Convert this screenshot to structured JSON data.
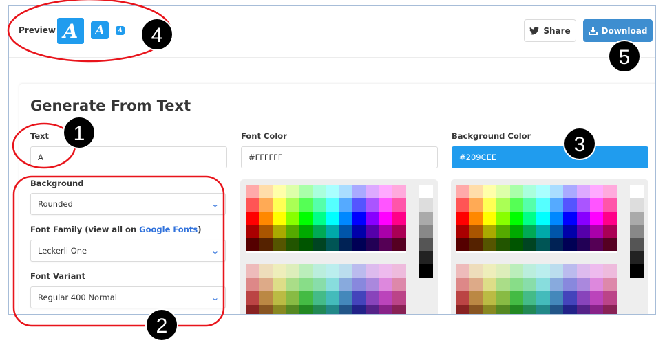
{
  "header": {
    "preview_label": "Preview",
    "preview_glyph": "A",
    "share_label": "Share",
    "share_icon": "twitter-icon",
    "download_label": "Download",
    "download_icon": "download-icon"
  },
  "form": {
    "title": "Generate From Text",
    "text_label": "Text",
    "text_value": "A",
    "font_color_label": "Font Color",
    "font_color_value": "#FFFFFF",
    "bg_color_label": "Background Color",
    "bg_color_value": "#209CEE",
    "background_label": "Background",
    "background_value": "Rounded",
    "font_family_label": "Font Family (view all on ",
    "font_family_link": "Google Fonts",
    "font_family_label_end": ")",
    "font_family_value": "Leckerli One",
    "font_variant_label": "Font Variant",
    "font_variant_value": "Regular 400 Normal"
  },
  "colors": {
    "accent": "#209CEE",
    "download": "#3E8ED0",
    "annotation": "#E8141B"
  },
  "palette": [
    [
      "#ffaaaa",
      "#ffddaa",
      "#ffffaa",
      "#ddffaa",
      "#aaffaa",
      "#aaffdd",
      "#aaffff",
      "#aaddff",
      "#aaaaff",
      "#ddaaff",
      "#ffaaff",
      "#ffaadd"
    ],
    [
      "#ff5555",
      "#ffaa55",
      "#ffff55",
      "#aaff55",
      "#55ff55",
      "#55ffaa",
      "#55ffff",
      "#55aaff",
      "#5555ff",
      "#aa55ff",
      "#ff55ff",
      "#ff55aa"
    ],
    [
      "#ff0000",
      "#ff8800",
      "#ffff00",
      "#88ff00",
      "#00ff00",
      "#00ff88",
      "#00ffff",
      "#0088ff",
      "#0000ff",
      "#8800ff",
      "#ff00ff",
      "#ff0088"
    ],
    [
      "#aa0000",
      "#aa5500",
      "#aaaa00",
      "#55aa00",
      "#00aa00",
      "#00aa55",
      "#00aaaa",
      "#0055aa",
      "#0000aa",
      "#5500aa",
      "#aa00aa",
      "#aa0055"
    ],
    [
      "#550000",
      "#552200",
      "#555500",
      "#225500",
      "#005500",
      "#004422",
      "#005555",
      "#002255",
      "#000055",
      "#220055",
      "#550055",
      "#550022"
    ],
    [
      "#eebbbb",
      "#eeddbb",
      "#eeeebb",
      "#ddeebb",
      "#bbeebb",
      "#bbeedd",
      "#bbeeee",
      "#bbddee",
      "#bbbbee",
      "#ddbbee",
      "#eebbee",
      "#eebbdd"
    ],
    [
      "#dd8888",
      "#ddaa88",
      "#dddd88",
      "#aadd88",
      "#88dd88",
      "#88ddaa",
      "#88dddd",
      "#88aadd",
      "#8888dd",
      "#aa88dd",
      "#dd88dd",
      "#dd88aa"
    ],
    [
      "#bb4444",
      "#bb8844",
      "#bbbb44",
      "#88bb44",
      "#44bb44",
      "#44bb88",
      "#44bbbb",
      "#4488bb",
      "#4444bb",
      "#8844bb",
      "#bb44bb",
      "#bb4488"
    ],
    [
      "#882222",
      "#885522",
      "#888822",
      "#558822",
      "#228822",
      "#228855",
      "#228888",
      "#225588",
      "#222288",
      "#552288",
      "#882288",
      "#882255"
    ],
    [
      "#441111",
      "#442211",
      "#444411",
      "#224411",
      "#114411",
      "#114422",
      "#114444",
      "#112244",
      "#111144",
      "#221144",
      "#441144",
      "#441122"
    ]
  ],
  "grays": [
    "#ffffff",
    "#dddddd",
    "#aaaaaa",
    "#888888",
    "#555555",
    "#222222",
    "#000000"
  ],
  "annotations": [
    "1",
    "2",
    "3",
    "4",
    "5"
  ]
}
